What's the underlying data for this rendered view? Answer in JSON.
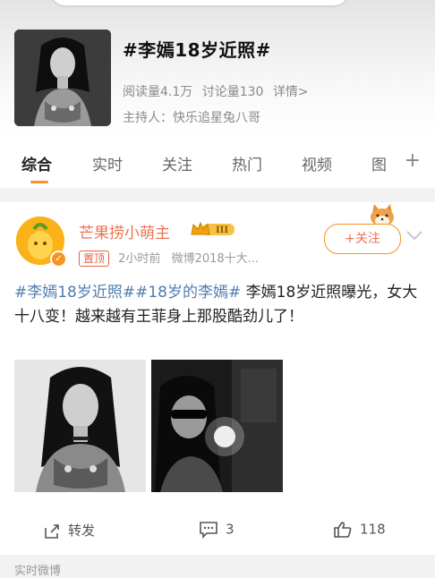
{
  "topic": {
    "title": "#李嫣18岁近照#",
    "read_count": "阅读量4.1万",
    "discuss_count": "讨论量130",
    "details_link": "详情>",
    "host": "主持人：快乐追星兔八哥"
  },
  "tabs": [
    {
      "label": "综合",
      "active": true
    },
    {
      "label": "实时",
      "active": false
    },
    {
      "label": "关注",
      "active": false
    },
    {
      "label": "热门",
      "active": false
    },
    {
      "label": "视频",
      "active": false
    },
    {
      "label": "图",
      "active": false
    }
  ],
  "tab_add_icon": "+",
  "post": {
    "author": "芒果捞小萌主",
    "crown_level": "III",
    "pin_label": "置顶",
    "time": "2小时前",
    "source": "微博2018十大...",
    "follow_label": "+关注",
    "hashtag1": "#李嫣18岁近照#",
    "hashtag2": "#18岁的李嫣#",
    "body": " 李嫣18岁近照曝光，女大十八变！越来越有王菲身上那股酷劲儿了！",
    "actions": {
      "repost_label": "转发",
      "comment_count": "3",
      "like_count": "118"
    }
  },
  "bottom_section_label": "实时微博",
  "colors": {
    "accent_orange": "#f7931e",
    "author_orange": "#eb7350",
    "hashtag_blue": "#507daf"
  }
}
